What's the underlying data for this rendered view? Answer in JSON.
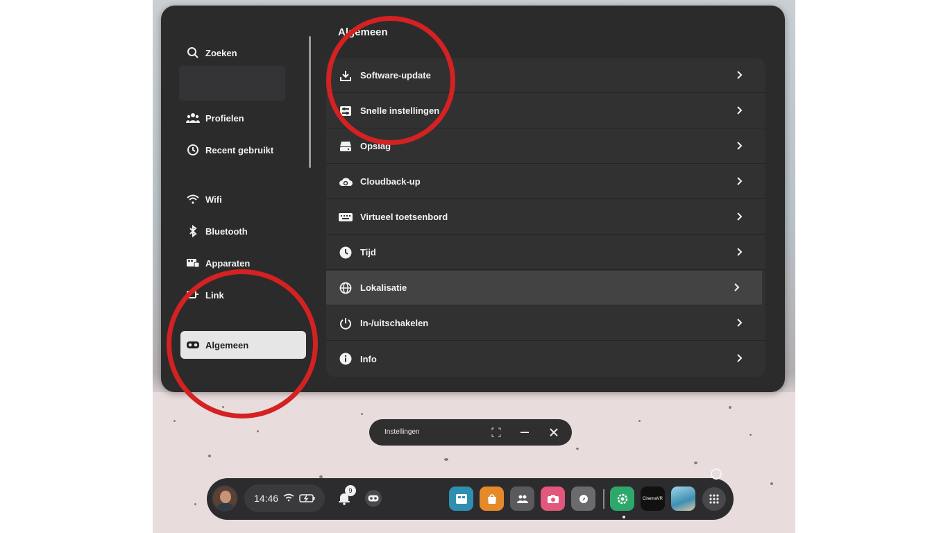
{
  "sidebar": {
    "search_label": "Zoeken",
    "items": [
      {
        "label": "Profielen",
        "icon": "people-icon"
      },
      {
        "label": "Recent gebruikt",
        "icon": "history-icon"
      },
      {
        "label": "Wifi",
        "icon": "wifi-icon"
      },
      {
        "label": "Bluetooth",
        "icon": "bluetooth-icon"
      },
      {
        "label": "Apparaten",
        "icon": "devices-icon"
      },
      {
        "label": "Link",
        "icon": "link-icon"
      },
      {
        "label": "Algemeen",
        "icon": "headset-icon",
        "active": true
      }
    ]
  },
  "main": {
    "title": "Algemeen",
    "rows": [
      {
        "label": "Software-update",
        "icon": "download-icon"
      },
      {
        "label": "Snelle instellingen",
        "icon": "sliders-icon"
      },
      {
        "label": "Opslag",
        "icon": "storage-icon"
      },
      {
        "label": "Cloudback-up",
        "icon": "cloud-sync-icon"
      },
      {
        "label": "Virtueel toetsenbord",
        "icon": "keyboard-icon"
      },
      {
        "label": "Tijd",
        "icon": "clock-icon"
      },
      {
        "label": "Lokalisatie",
        "icon": "globe-icon",
        "highlighted": true
      },
      {
        "label": "In-/uitschakelen",
        "icon": "power-icon"
      },
      {
        "label": "Info",
        "icon": "info-icon"
      }
    ]
  },
  "app_bar": {
    "title": "Instellingen"
  },
  "dock": {
    "time": "14:46",
    "notification_count": "9",
    "apps": [
      {
        "name": "tv-app-icon",
        "color": "#2f8fb1"
      },
      {
        "name": "store-app-icon",
        "color": "#e58a2b"
      },
      {
        "name": "people-app-icon",
        "color": "#5a5a5c"
      },
      {
        "name": "camera-app-icon",
        "color": "#e2577c"
      },
      {
        "name": "fitness-app-icon",
        "color": "#6b6b6d"
      },
      {
        "name": "settings-app-icon",
        "color": "#2ea76a"
      },
      {
        "name": "cinema-app-icon",
        "color": "#111111",
        "label": "CinemaVR"
      },
      {
        "name": "game-app-icon",
        "color": "#4aa7c9"
      }
    ]
  },
  "colors": {
    "annotation_red": "#d42121",
    "window_bg": "#2b2b2c",
    "active_item_bg": "#e6e6e6"
  }
}
